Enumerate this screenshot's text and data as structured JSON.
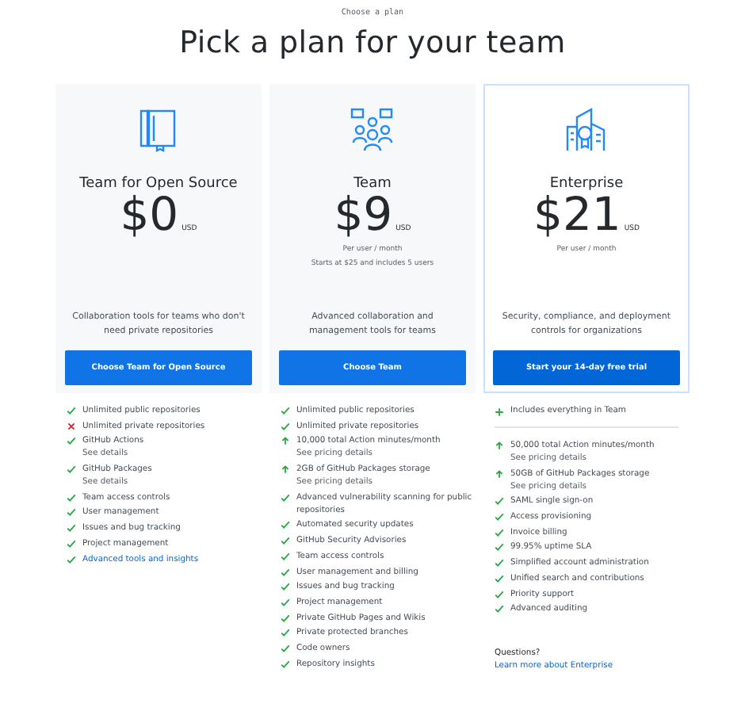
{
  "eyebrow": "Choose a plan",
  "title": "Pick a plan for your team",
  "plans": [
    {
      "kind": "book",
      "name": "Team for Open Source",
      "price": "$0",
      "currency": "USD",
      "description": "Collaboration tools for teams who don't need private repositories",
      "button": "Choose Team for Open Source",
      "highlighted": false,
      "features": [
        {
          "kind": "check",
          "text": "Unlimited public repositories"
        },
        {
          "kind": "cross",
          "text": "Unlimited private repositories"
        },
        {
          "kind": "check",
          "text": "GitHub Actions",
          "note": "See details"
        },
        {
          "kind": "check",
          "text": "GitHub Packages",
          "note": "See details"
        },
        {
          "kind": "check",
          "text": "Team access controls"
        },
        {
          "kind": "check",
          "text": "User management"
        },
        {
          "kind": "check",
          "text": "Issues and bug tracking"
        },
        {
          "kind": "check",
          "text": "Project management"
        },
        {
          "kind": "link",
          "text": "Advanced tools and insights"
        }
      ]
    },
    {
      "kind": "people",
      "name": "Team",
      "price": "$9",
      "currency": "USD",
      "notes": [
        "Per user / month",
        "Starts at $25 and includes 5 users"
      ],
      "description": "Advanced collaboration and management tools for teams",
      "button": "Choose Team",
      "highlighted": false,
      "features": [
        {
          "kind": "check",
          "text": "Unlimited public repositories"
        },
        {
          "kind": "check",
          "text": "Unlimited private repositories"
        },
        {
          "kind": "up",
          "text": "10,000 total Action minutes/month",
          "note": "See pricing details"
        },
        {
          "kind": "up",
          "text": "2GB of GitHub Packages storage",
          "note": "See pricing details"
        },
        {
          "kind": "check",
          "text": "Advanced vulnerability scanning for public repositories"
        },
        {
          "kind": "check",
          "text": "Automated security updates"
        },
        {
          "kind": "check",
          "text": "GitHub Security Advisories"
        },
        {
          "kind": "check",
          "text": "Team access controls"
        },
        {
          "kind": "check",
          "text": "User management and billing"
        },
        {
          "kind": "check",
          "text": "Issues and bug tracking"
        },
        {
          "kind": "check",
          "text": "Project management"
        },
        {
          "kind": "check",
          "text": "Private GitHub Pages and Wikis"
        },
        {
          "kind": "check",
          "text": "Private protected branches"
        },
        {
          "kind": "check",
          "text": "Code owners"
        },
        {
          "kind": "check",
          "text": "Repository insights"
        }
      ]
    },
    {
      "kind": "building",
      "name": "Enterprise",
      "price": "$21",
      "currency": "USD",
      "notes": [
        "Per user / month"
      ],
      "description": "Security, compliance, and deployment controls for organizations",
      "button": "Start your 14-day free trial",
      "highlighted": true,
      "includes": "Includes everything in Team",
      "features": [
        {
          "kind": "up",
          "text": "50,000 total Action minutes/month",
          "note": "See pricing details"
        },
        {
          "kind": "up",
          "text": "50GB of GitHub Packages storage",
          "note": "See pricing details"
        },
        {
          "kind": "check",
          "text": "SAML single sign-on"
        },
        {
          "kind": "check",
          "text": "Access provisioning"
        },
        {
          "kind": "check",
          "text": "Invoice billing"
        },
        {
          "kind": "check",
          "text": "99.95% uptime SLA"
        },
        {
          "kind": "check",
          "text": "Simplified account administration"
        },
        {
          "kind": "check",
          "text": "Unified search and contributions"
        },
        {
          "kind": "check",
          "text": "Priority support"
        },
        {
          "kind": "check",
          "text": "Advanced auditing"
        }
      ],
      "questions": "Questions?",
      "questions_link": "Learn more about Enterprise"
    }
  ]
}
